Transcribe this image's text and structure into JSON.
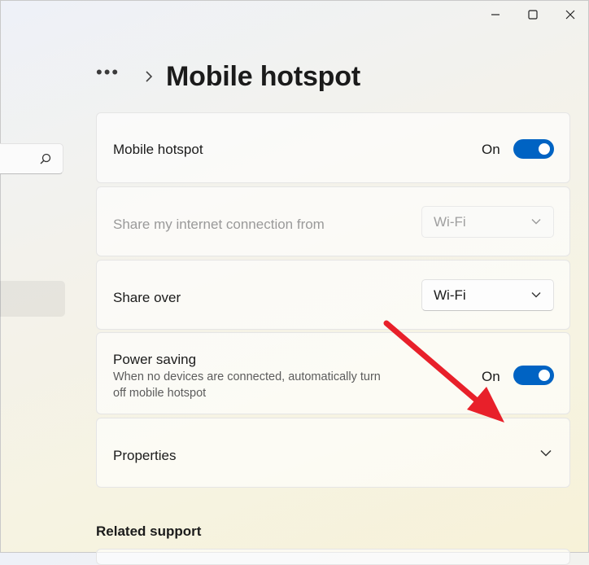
{
  "window": {
    "minimize_icon": "minimize-icon",
    "maximize_icon": "maximize-icon",
    "close_icon": "close-icon"
  },
  "sidebar": {
    "search_icon": "search-icon"
  },
  "header": {
    "breadcrumb_more": "•••",
    "title": "Mobile hotspot"
  },
  "settings": {
    "mobile_hotspot": {
      "label": "Mobile hotspot",
      "state": "On",
      "enabled": true
    },
    "share_from": {
      "label": "Share my internet connection from",
      "value": "Wi-Fi",
      "disabled": true
    },
    "share_over": {
      "label": "Share over",
      "value": "Wi-Fi"
    },
    "power_saving": {
      "label": "Power saving",
      "description": "When no devices are connected, automatically turn off mobile hotspot",
      "state": "On",
      "enabled": true
    },
    "properties": {
      "label": "Properties"
    }
  },
  "related": {
    "heading": "Related support"
  },
  "colors": {
    "accent": "#0063c3",
    "annotation_arrow": "#e8202a"
  }
}
